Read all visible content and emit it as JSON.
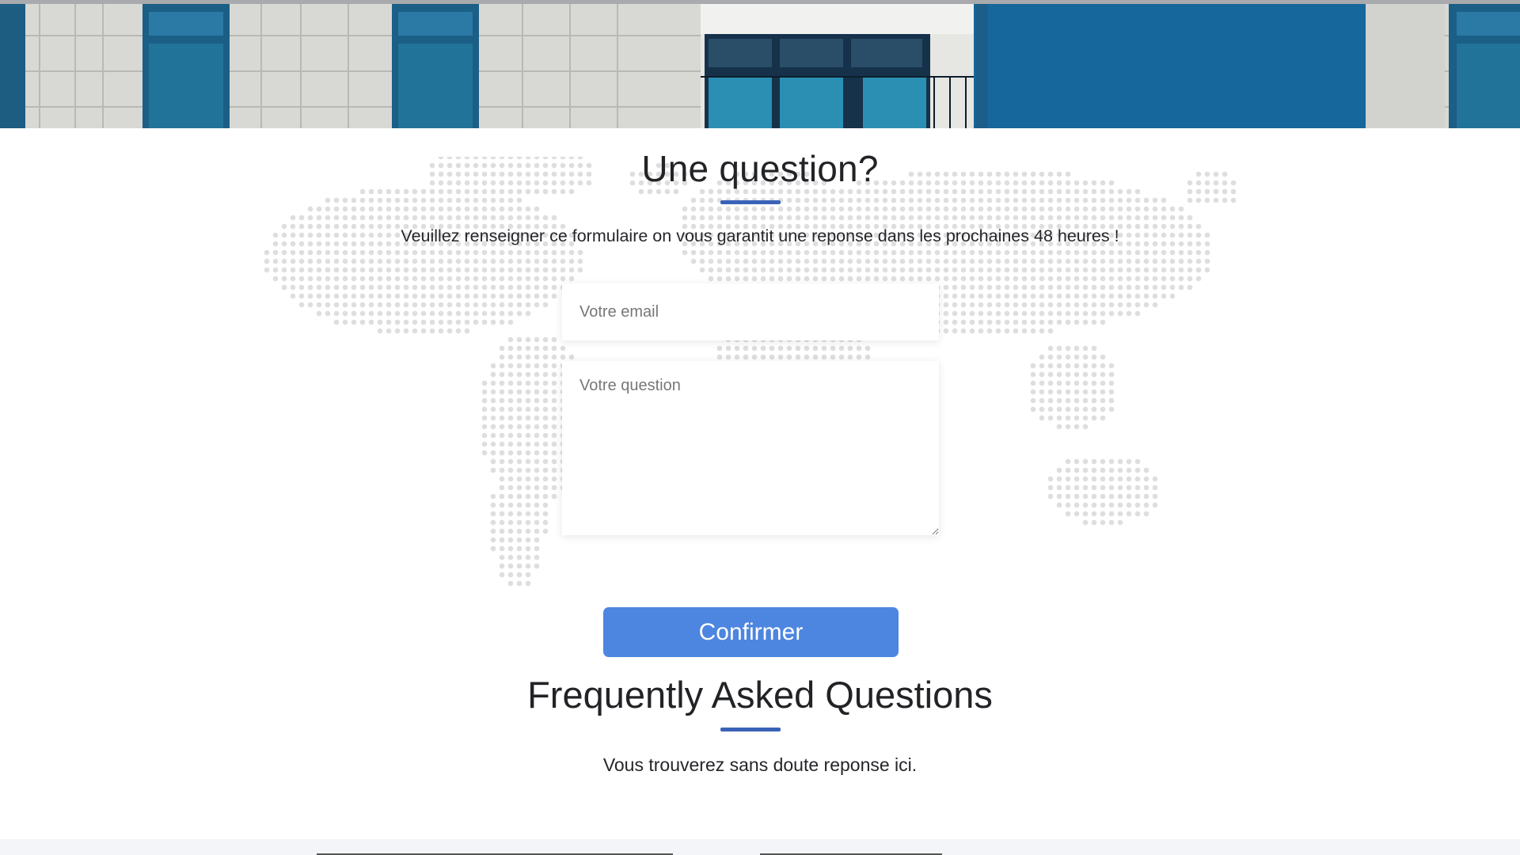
{
  "hero": {
    "image_icon": "building-facade-photo",
    "colors": {
      "wall": "#d7d7d4",
      "glass": "#1f6e96",
      "blue_panel": "#16679b"
    }
  },
  "world_map": {
    "icon": "world-map-dotted",
    "dot_color": "#dedede"
  },
  "question_section": {
    "title": "Une question?",
    "subtitle": "Veuillez renseigner ce formulaire on vous garantit une reponse dans les prochaines 48 heures !",
    "email_placeholder": "Votre email",
    "question_placeholder": "Votre question",
    "confirm_label": "Confirmer"
  },
  "faq_section": {
    "title": "Frequently Asked Questions",
    "subtitle": "Vous trouverez sans doute reponse ici."
  },
  "colors": {
    "accent": "#3a63b8",
    "button": "#4d86e0",
    "text": "#222326"
  }
}
